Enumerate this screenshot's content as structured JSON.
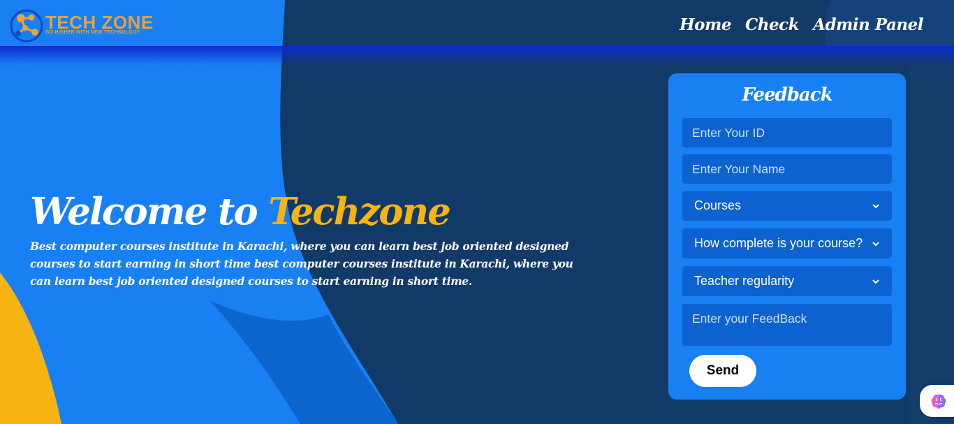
{
  "brand": {
    "name": "TECH ZONE",
    "tagline": "GO HIGHER WITH NEW TECHNOLOGY",
    "logo_icon": "molecule-logo-icon",
    "color": "#e9a13b"
  },
  "nav": {
    "items": [
      {
        "label": "Home"
      },
      {
        "label": "Check"
      },
      {
        "label": "Admin Panel"
      }
    ]
  },
  "hero": {
    "title_prefix": "Welcome to ",
    "title_accent": "Techzone",
    "accent_color": "#f6b312",
    "description": "Best computer courses institute in Karachi, where you can learn best job oriented designed courses to start earning in short time best computer courses institute in Karachi, where you can learn best job oriented designed courses to start earning in short time."
  },
  "feedback": {
    "title": "Feedback",
    "id_placeholder": "Enter Your ID",
    "name_placeholder": "Enter Your Name",
    "courses_value": "Courses",
    "completion_value": "How complete is your course?",
    "regularity_value": "Teacher regularity",
    "feedback_placeholder": "Enter your FeedBack",
    "send_label": "Send"
  },
  "assistant": {
    "icon": "brain-icon"
  },
  "colors": {
    "dark_blue": "#123a68",
    "bright_blue": "#1880f2",
    "yellow": "#f6b312"
  }
}
